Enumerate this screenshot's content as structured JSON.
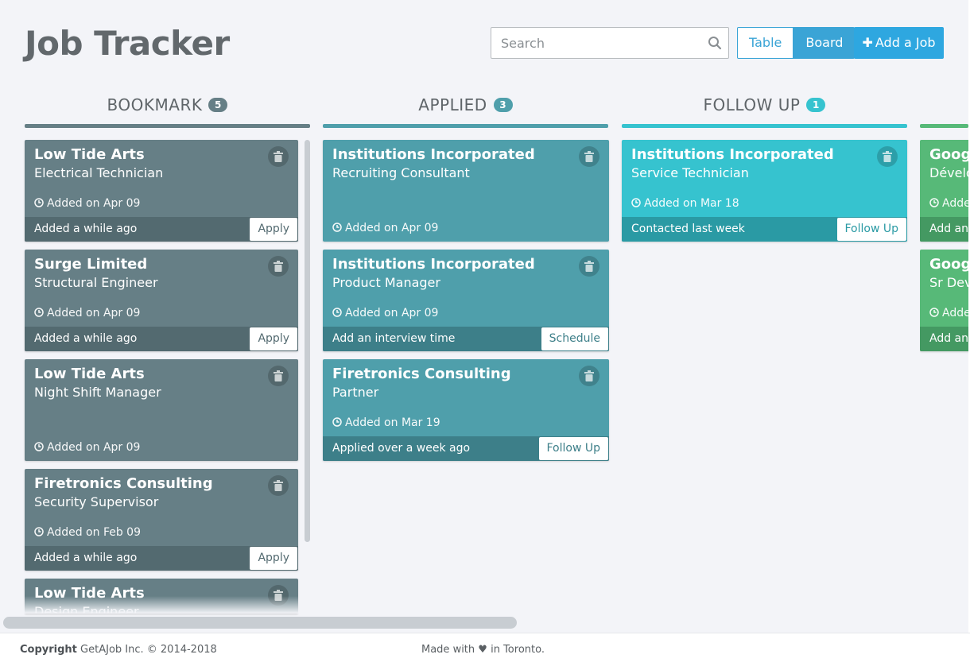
{
  "app": {
    "title": "Job Tracker"
  },
  "search": {
    "placeholder": "Search"
  },
  "view_toggle": {
    "table_label": "Table",
    "board_label": "Board",
    "active": "Board"
  },
  "add_job": {
    "label": "Add a Job"
  },
  "colors": {
    "accent": "#2ea7e0",
    "bookmark": "#667f86",
    "applied": "#4f9fab",
    "follow_up": "#36c3cf",
    "offer": "#57b978"
  },
  "columns": [
    {
      "title": "BOOKMARK",
      "count": "5",
      "cards": [
        {
          "company": "Low Tide Arts",
          "role": "Electrical Technician",
          "added": "Added on Apr 09",
          "footer": "Added a while ago",
          "action": "Apply"
        },
        {
          "company": "Surge Limited",
          "role": "Structural Engineer",
          "added": "Added on Apr 09",
          "footer": "Added a while ago",
          "action": "Apply"
        },
        {
          "company": "Low Tide Arts",
          "role": "Night Shift Manager",
          "added": "Added on Apr 09"
        },
        {
          "company": "Firetronics Consulting",
          "role": "Security Supervisor",
          "added": "Added on Feb 09",
          "footer": "Added a while ago",
          "action": "Apply"
        },
        {
          "company": "Low Tide Arts",
          "role": "Design Engineer"
        }
      ]
    },
    {
      "title": "APPLIED",
      "count": "3",
      "cards": [
        {
          "company": "Institutions Incorporated",
          "role": "Recruiting Consultant",
          "added": "Added on Apr 09"
        },
        {
          "company": "Institutions Incorporated",
          "role": "Product Manager",
          "added": "Added on Apr 09",
          "footer": "Add an interview time",
          "action": "Schedule"
        },
        {
          "company": "Firetronics Consulting",
          "role": "Partner",
          "added": "Added on Mar 19",
          "footer": "Applied over a week ago",
          "action": "Follow Up"
        }
      ]
    },
    {
      "title": "FOLLOW UP",
      "count": "1",
      "cards": [
        {
          "company": "Institutions Incorporated",
          "role": "Service Technician",
          "added": "Added on Mar 18",
          "footer": "Contacted last week",
          "action": "Follow Up"
        }
      ]
    },
    {
      "title": "",
      "count": "",
      "cards": [
        {
          "company": "Googl",
          "role": "Dévelo",
          "added": "Adde",
          "footer": "Add an"
        },
        {
          "company": "Googl",
          "role": "Sr Dev",
          "added": "Adde",
          "footer": "Add an"
        }
      ]
    }
  ],
  "footer": {
    "copyright_label": "Copyright",
    "copyright_text": "GetAJob Inc. © 2014-2018",
    "made_with": "Made with",
    "heart_icon": "heart-icon",
    "made_in": "in Toronto."
  }
}
